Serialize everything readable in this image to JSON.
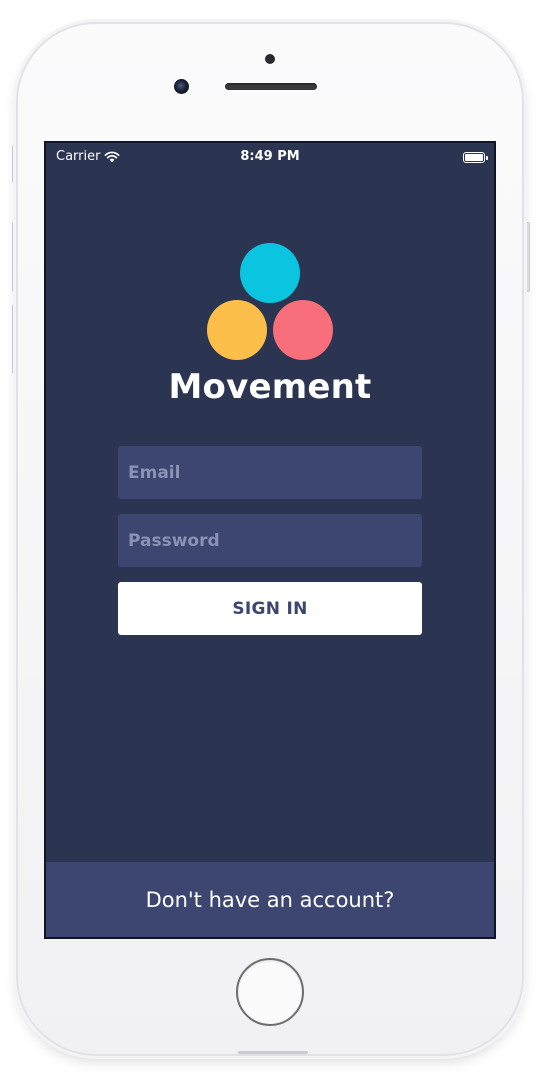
{
  "status_bar": {
    "carrier": "Carrier",
    "time": "8:49 PM",
    "wifi_icon": "wifi-icon",
    "battery_icon": "battery-icon"
  },
  "logo": {
    "icon": "three-circles-logo-icon",
    "colors": {
      "cyan": "#0bc4e0",
      "yellow": "#fcbf4a",
      "pink": "#f86e7a"
    }
  },
  "app": {
    "title": "Movement"
  },
  "form": {
    "email_placeholder": "Email",
    "email_value": "",
    "password_placeholder": "Password",
    "password_value": "",
    "signin_label": "SIGN IN"
  },
  "footer": {
    "signup_prompt": "Don't have an account?"
  },
  "theme": {
    "background": "#2b3450",
    "field_background": "#3c4670",
    "button_text": "#3c4670"
  }
}
